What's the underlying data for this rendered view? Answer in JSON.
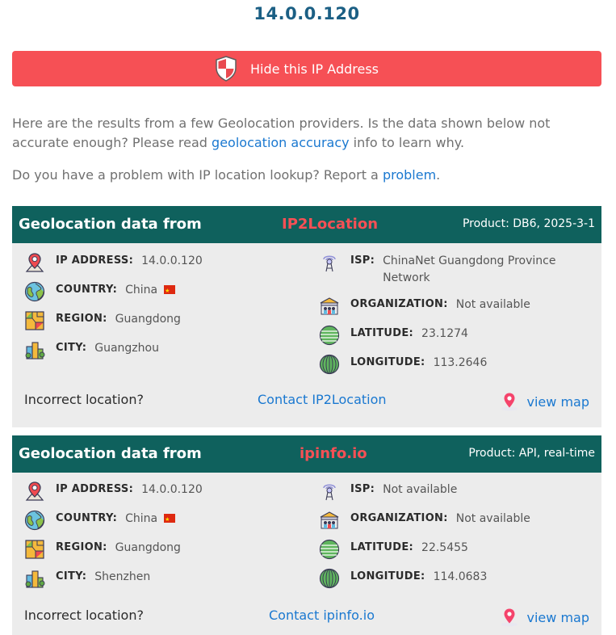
{
  "ip_title": "14.0.0.120",
  "hide_button": {
    "label": "Hide this IP Address",
    "icon": "shield-icon",
    "color": "#f65055"
  },
  "intro": {
    "p1_before": "Here are the results from a few Geolocation providers. Is the data shown below not accurate enough? Please read ",
    "p1_link": "geolocation accuracy",
    "p1_after": " info to learn why.",
    "p2_before": "Do you have a problem with IP location lookup? Report a ",
    "p2_link": "problem",
    "p2_after": "."
  },
  "cards": [
    {
      "lead": "Geolocation data from",
      "provider": "IP2Location",
      "product": "Product: DB6, 2025-3-1",
      "ip_label": "IP ADDRESS:",
      "ip_value": "14.0.0.120",
      "country_label": "COUNTRY:",
      "country_value": "China",
      "region_label": "REGION:",
      "region_value": "Guangdong",
      "city_label": "CITY:",
      "city_value": "Guangzhou",
      "isp_label": "ISP:",
      "isp_value": "ChinaNet Guangdong Province Network",
      "org_label": "ORGANIZATION:",
      "org_value": "Not available",
      "lat_label": "LATITUDE:",
      "lat_value": "23.1274",
      "lon_label": "LONGITUDE:",
      "lon_value": "113.2646",
      "incorrect": "Incorrect location?",
      "contact": "Contact IP2Location",
      "view_map": "view map"
    },
    {
      "lead": "Geolocation data from",
      "provider": "ipinfo.io",
      "product": "Product: API, real-time",
      "ip_label": "IP ADDRESS:",
      "ip_value": "14.0.0.120",
      "country_label": "COUNTRY:",
      "country_value": "China",
      "region_label": "REGION:",
      "region_value": "Guangdong",
      "city_label": "CITY:",
      "city_value": "Shenzhen",
      "isp_label": "ISP:",
      "isp_value": "Not available",
      "org_label": "ORGANIZATION:",
      "org_value": "Not available",
      "lat_label": "LATITUDE:",
      "lat_value": "22.5455",
      "lon_label": "LONGITUDE:",
      "lon_value": "114.0683",
      "incorrect": "Incorrect location?",
      "contact": "Contact ipinfo.io",
      "view_map": "view map"
    }
  ],
  "colors": {
    "header": "#0f615d",
    "provider": "#f65055",
    "link": "#1a78d0",
    "title": "#1b5f84"
  }
}
